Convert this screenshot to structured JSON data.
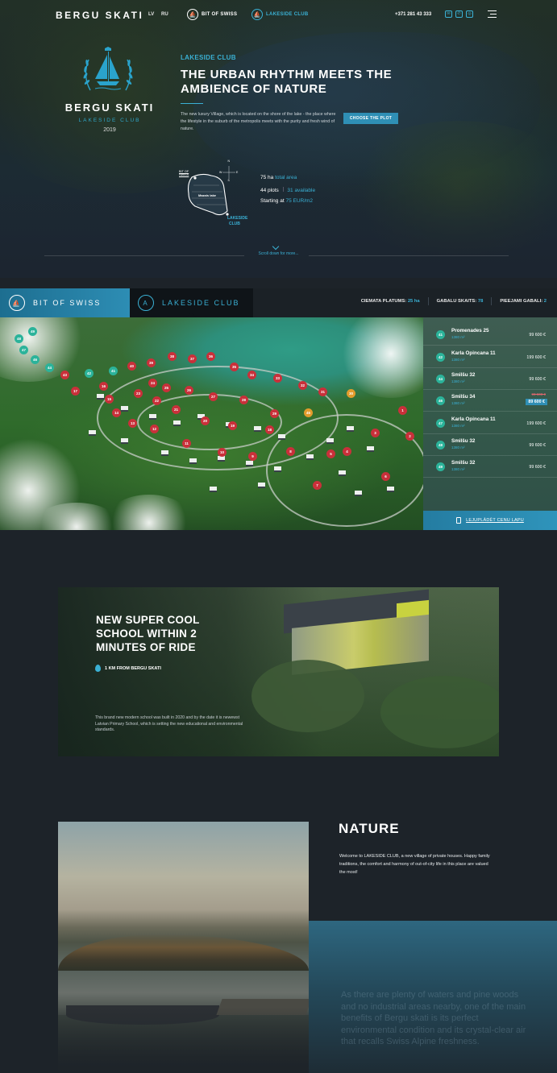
{
  "header": {
    "brand": "BERGU SKATI",
    "lang_lv": "LV",
    "lang_ru": "RU",
    "nav_bit_of_swiss": "BIT OF SWISS",
    "nav_lakeside_club": "LAKESIDE CLUB",
    "phone": "+371 281 43 333",
    "social": [
      {
        "icon": "mail-icon",
        "glyph": "✉"
      },
      {
        "icon": "phone-icon",
        "glyph": "✆"
      },
      {
        "icon": "instagram-icon",
        "glyph": "◎"
      }
    ]
  },
  "hero": {
    "brand_title": "BERGU SKATI",
    "brand_subtitle": "LAKESIDE CLUB",
    "year": "2019",
    "kicker": "LAKESIDE CLUB",
    "headline": "THE URBAN RHYTHM MEETS THE AMBIENCE OF NATURE",
    "lead": "The new luxury Village, which is located on the shore of the lake - the place where the lifestyle in the suburb of the metropolis meets with the purity and fresh wind of nature.",
    "cta_label": "CHOOSE THE PLOT",
    "map": {
      "bit_of_swiss_label": "BIT OF SWISS",
      "lake_label": "Mazais lake",
      "lakeside_label_1": "LAKESIDE",
      "lakeside_label_2": "CLUB",
      "compass_n": "N",
      "compass_s": "S",
      "compass_w": "W",
      "compass_e": "E"
    },
    "stats": {
      "area_value": "75 ha",
      "area_label": "total area",
      "plots_value": "44 plots",
      "plots_available": "31 available",
      "price_prefix": "Starting at",
      "price_value": "75 EUR/m2"
    },
    "scroll_hint": "Scroll down for more..."
  },
  "tabs": {
    "bit_of_swiss": "BIT OF SWISS",
    "lakeside_club": "LAKESIDE CLUB",
    "stat_area_label": "CIEMATA PLATUMS:",
    "stat_area_value": "25 ha",
    "stat_count_label": "GABALU SKAITS:",
    "stat_count_value": "78",
    "stat_avail_label": "PIEEJAMI GABALI:",
    "stat_avail_value": "2"
  },
  "plot_pins": [
    {
      "n": "49",
      "c": "teal"
    },
    {
      "n": "48",
      "c": "teal"
    },
    {
      "n": "47",
      "c": "teal"
    },
    {
      "n": "46",
      "c": "teal"
    },
    {
      "n": "44",
      "c": "teal"
    },
    {
      "n": "43",
      "c": "red"
    },
    {
      "n": "42",
      "c": "teal"
    },
    {
      "n": "41",
      "c": "teal"
    },
    {
      "n": "40",
      "c": "red"
    },
    {
      "n": "39",
      "c": "red"
    },
    {
      "n": "38",
      "c": "red"
    },
    {
      "n": "37",
      "c": "red"
    },
    {
      "n": "36",
      "c": "red"
    },
    {
      "n": "35",
      "c": "red"
    },
    {
      "n": "34",
      "c": "red"
    },
    {
      "n": "33",
      "c": "red"
    },
    {
      "n": "32",
      "c": "red"
    },
    {
      "n": "31",
      "c": "red"
    },
    {
      "n": "30",
      "c": "orange"
    },
    {
      "n": "29",
      "c": "red"
    },
    {
      "n": "28",
      "c": "red"
    },
    {
      "n": "27",
      "c": "red"
    },
    {
      "n": "26",
      "c": "red"
    },
    {
      "n": "25",
      "c": "red"
    },
    {
      "n": "24",
      "c": "red"
    },
    {
      "n": "23",
      "c": "red"
    },
    {
      "n": "22",
      "c": "red"
    },
    {
      "n": "21",
      "c": "red"
    },
    {
      "n": "20",
      "c": "red"
    },
    {
      "n": "19",
      "c": "red"
    },
    {
      "n": "18",
      "c": "red"
    },
    {
      "n": "17",
      "c": "red"
    },
    {
      "n": "16",
      "c": "red"
    },
    {
      "n": "15",
      "c": "red"
    },
    {
      "n": "14",
      "c": "red"
    },
    {
      "n": "13",
      "c": "red"
    },
    {
      "n": "12",
      "c": "red"
    },
    {
      "n": "11",
      "c": "red"
    },
    {
      "n": "10",
      "c": "red"
    },
    {
      "n": "9",
      "c": "red"
    },
    {
      "n": "8",
      "c": "red"
    },
    {
      "n": "7",
      "c": "red"
    },
    {
      "n": "6",
      "c": "red"
    },
    {
      "n": "5",
      "c": "red"
    },
    {
      "n": "4",
      "c": "red"
    },
    {
      "n": "3",
      "c": "red"
    },
    {
      "n": "2",
      "c": "red"
    },
    {
      "n": "1",
      "c": "red"
    },
    {
      "n": "45",
      "c": "orange"
    }
  ],
  "plots": [
    {
      "num": "41",
      "street": "Promenades 25",
      "area": "1380 m²",
      "price": "99 600 €"
    },
    {
      "num": "42",
      "street": "Karla Opincana 11",
      "area": "1380 m²",
      "price": "199 600 €"
    },
    {
      "num": "44",
      "street": "Smilšu 32",
      "area": "1380 m²",
      "price": "99 600 €"
    },
    {
      "num": "46",
      "street": "Smilšu 34",
      "area": "1380 m²",
      "old_price": "99 600 €",
      "price": "89 600 €",
      "sale": true
    },
    {
      "num": "47",
      "street": "Karla Opincana 11",
      "area": "1380 m²",
      "price": "199 600 €"
    },
    {
      "num": "48",
      "street": "Smilšu 32",
      "area": "1380 m²",
      "price": "99 600 €"
    },
    {
      "num": "49",
      "street": "Smilšu 32",
      "area": "1380 m²",
      "price": "99 600 €"
    }
  ],
  "download_label": "LEJUPLĀDĒT CENU LAPU",
  "school": {
    "title": "NEW SUPER COOL SCHOOL WITHIN 2 MINUTES OF RIDE",
    "location": "1 KM FROM BERGU SKATI",
    "description": "This brand new modern school was built in 2020 and by the date it is newewst Latvian Primary School, which is setting the new educational and environmental standards."
  },
  "nature": {
    "title": "NATURE",
    "text": "Welcome to LAKESIDE CLUB, a new village of private houses. Happy family traditions, the comfort and harmony of out-of-city life in this place are valued the most!",
    "faded_text": "As there are plenty of waters and pine woods and no industrial areas nearby, one of the main benefits of Bergu skati is its perfect environmental condition and its crystal-clear air that recalls Swiss Alpine freshness."
  }
}
